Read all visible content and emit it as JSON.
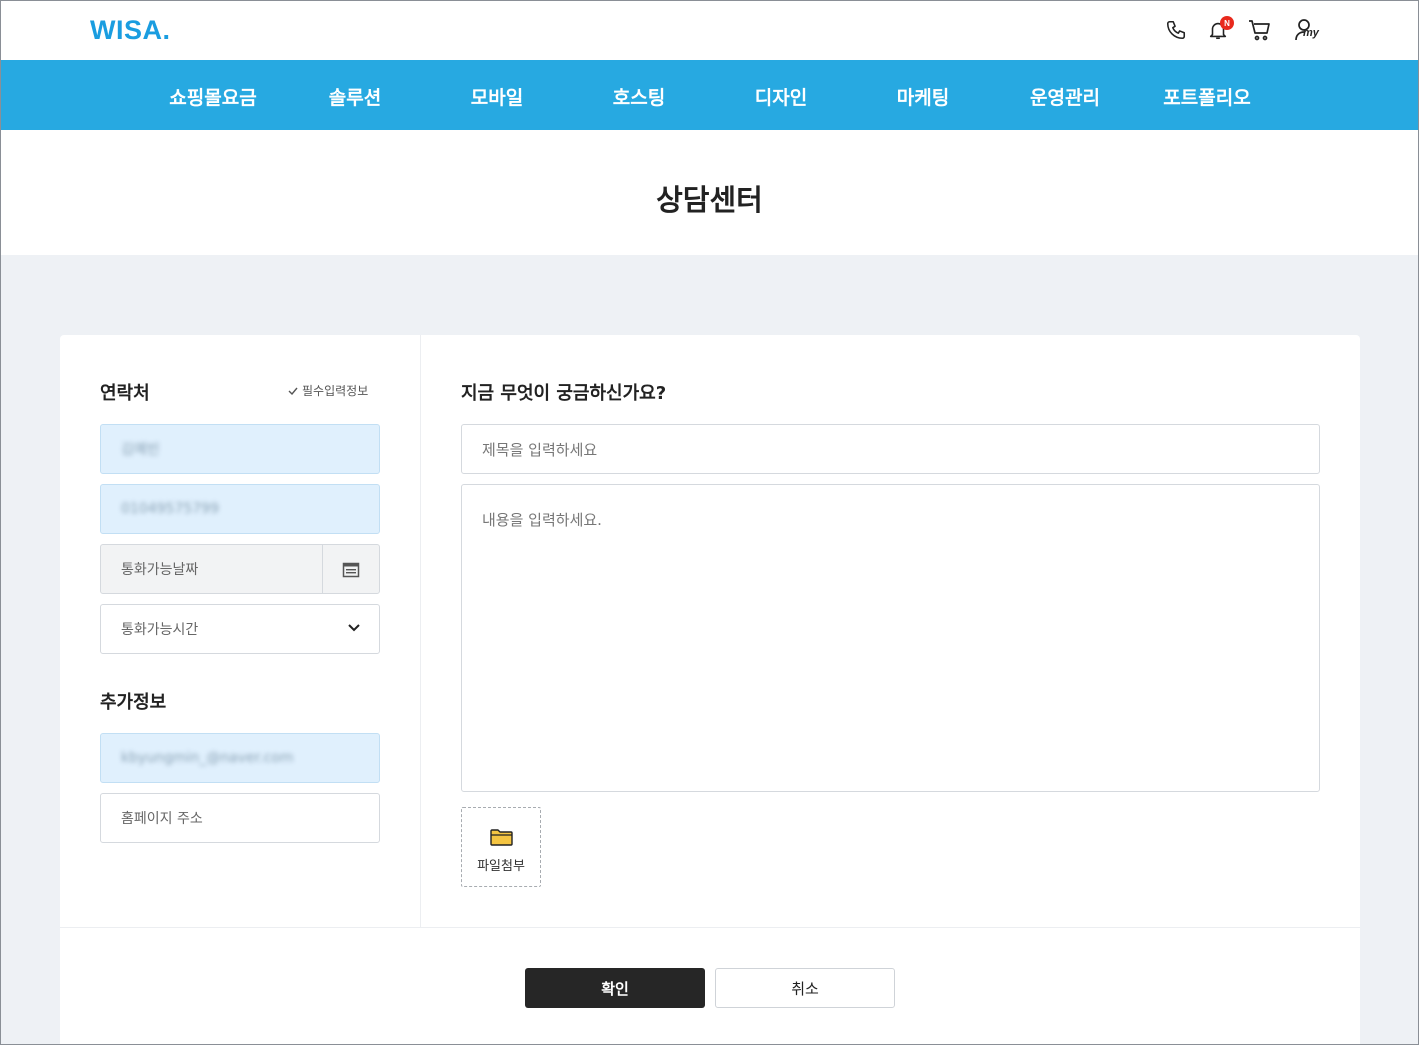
{
  "header": {
    "logo": "WISA.",
    "bell_badge": "N",
    "my_label": "my",
    "icons": [
      "phone-icon",
      "bell-icon",
      "cart-icon",
      "my-user-icon"
    ]
  },
  "nav": {
    "items": [
      "쇼핑몰요금",
      "솔루션",
      "모바일",
      "호스팅",
      "디자인",
      "마케팅",
      "운영관리",
      "포트폴리오"
    ]
  },
  "page": {
    "title": "상담센터"
  },
  "contact": {
    "title": "연락처",
    "required_note": "필수입력정보",
    "name_value": "김예빈",
    "phone_value": "01049575799",
    "date_placeholder": "통화가능날짜",
    "time_placeholder": "통화가능시간"
  },
  "extra": {
    "title": "추가정보",
    "email_value": "kbyungmin_@naver.com",
    "homepage_placeholder": "홈페이지 주소"
  },
  "inquiry": {
    "title": "지금 무엇이 궁금하신가요?",
    "subject_placeholder": "제목을 입력하세요",
    "content_placeholder": "내용을 입력하세요.",
    "attach_label": "파일첨부"
  },
  "actions": {
    "confirm": "확인",
    "cancel": "취소"
  },
  "colors": {
    "brand": "#1a9de0",
    "nav_bg": "#27a9e1",
    "filled_bg": "#e0f0fd",
    "badge": "#e8291c",
    "primary_btn": "#262626"
  }
}
